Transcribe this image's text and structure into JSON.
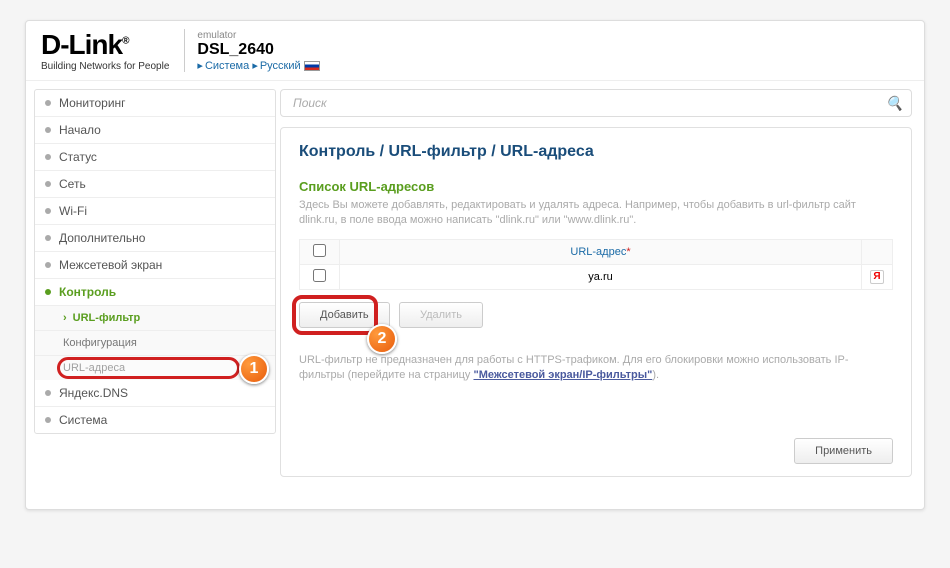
{
  "header": {
    "logo": "D-Link",
    "logo_reg": "®",
    "tagline": "Building Networks for People",
    "emulator": "emulator",
    "model": "DSL_2640",
    "sys_system": "Система",
    "sys_lang": "Русский"
  },
  "sidebar": {
    "items": [
      "Мониторинг",
      "Начало",
      "Статус",
      "Сеть",
      "Wi-Fi",
      "Дополнительно",
      "Межсетевой экран",
      "Контроль",
      "Яндекс.DNS",
      "Система"
    ],
    "submenu": {
      "filter": "URL-фильтр",
      "config": "Конфигурация",
      "addresses": "URL-адреса"
    }
  },
  "search": {
    "placeholder": "Поиск"
  },
  "breadcrumb": "Контроль /  URL-фильтр /  URL-адреса",
  "section": {
    "title": "Список URL-адресов",
    "desc": "Здесь Вы можете добавлять, редактировать и удалять адреса.\nНапример, чтобы добавить в url-фильтр сайт dlink.ru, в поле ввода можно написать \"dlink.ru\" или \"www.dlink.ru\"."
  },
  "table": {
    "col_url": "URL-адрес",
    "rows": [
      {
        "url": "ya.ru"
      }
    ]
  },
  "buttons": {
    "add": "Добавить",
    "delete": "Удалить",
    "apply": "Применить"
  },
  "note": {
    "text_before": "URL-фильтр не предназначен для работы с HTTPS-трафиком. Для его блокировки можно использовать IP-фильтры (перейдите на страницу ",
    "link": "\"Межсетевой экран/IP-фильтры\"",
    "text_after": ")."
  },
  "annotations": {
    "one": "1",
    "two": "2"
  }
}
